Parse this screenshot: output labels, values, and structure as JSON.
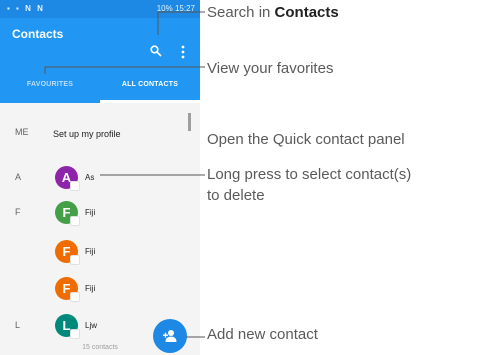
{
  "status_bar": {
    "left_icons": "▪ ▪ N N",
    "right": "10% 15:27"
  },
  "toolbar": {
    "title": "Contacts"
  },
  "tabs": [
    {
      "label": "FAVOURITES"
    },
    {
      "label": "ALL CONTACTS"
    }
  ],
  "me_row": {
    "letter": "ME",
    "text": "Set up my profile"
  },
  "contacts": [
    {
      "letter": "A",
      "initial": "A",
      "name": "As",
      "color": "#8e24aa"
    },
    {
      "letter": "F",
      "initial": "F",
      "name": "Fiji",
      "color": "#43a047"
    },
    {
      "letter": "",
      "initial": "F",
      "name": "Fiji",
      "color": "#ef6c00"
    },
    {
      "letter": "",
      "initial": "F",
      "name": "Fiji",
      "color": "#ef6c00"
    },
    {
      "letter": "L",
      "initial": "L",
      "name": "Ljw",
      "color": "#00897b"
    }
  ],
  "contact_count": "15 contacts",
  "callouts": {
    "search_prefix": "Search in ",
    "search_bold": "Contacts",
    "favorites": "View your favorites",
    "quick_contact": "Open the Quick contact panel",
    "long_press_line1": "Long press to select contact(s)",
    "long_press_line2": "to delete",
    "add_contact": "Add new contact"
  },
  "colors": {
    "primary": "#2196f3",
    "status": "#1e88e5",
    "fab": "#1e88e5"
  }
}
